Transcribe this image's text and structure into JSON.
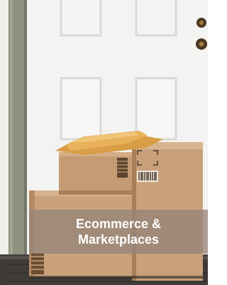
{
  "tile": {
    "caption": "Ecommerce &\nMarketplaces"
  },
  "photo": {
    "subject": "parcel-boxes-at-door",
    "colors": {
      "door": "#f3f3f1",
      "door_shadow": "#d9d9d6",
      "frame": "#8e937f",
      "wall": "#e7e6e1",
      "cardboard": "#c9a27c",
      "cardboard_dark": "#a77e58",
      "envelope": "#e8b25a",
      "mat": "#3e3b38",
      "hardware": "#4b3622",
      "caption_overlay": "#968478"
    }
  }
}
